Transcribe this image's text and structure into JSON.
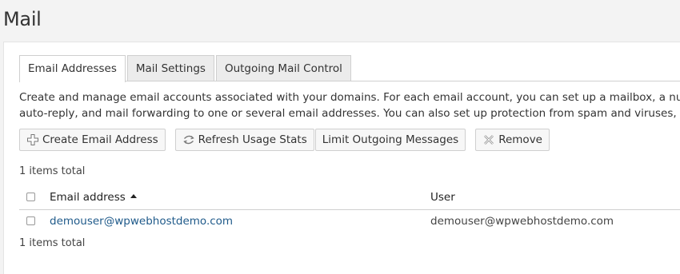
{
  "page": {
    "title": "Mail"
  },
  "tabs": [
    {
      "label": "Email Addresses",
      "active": true
    },
    {
      "label": "Mail Settings",
      "active": false
    },
    {
      "label": "Outgoing Mail Control",
      "active": false
    }
  ],
  "description": {
    "line1": "Create and manage email accounts associated with your domains. For each email account, you can set up a mailbox, a number of additio",
    "line2": "auto-reply, and mail forwarding to one or several email addresses. You can also set up protection from spam and viruses, if these service"
  },
  "toolbar": {
    "create_label": "Create Email Address",
    "refresh_label": "Refresh Usage Stats",
    "limit_label": "Limit Outgoing Messages",
    "remove_label": "Remove"
  },
  "list": {
    "count_text": "1 items total",
    "columns": {
      "email": "Email address",
      "user": "User"
    },
    "sort": "ascending",
    "rows": [
      {
        "email": "demouser@wpwebhostdemo.com",
        "user": "demouser@wpwebhostdemo.com"
      }
    ]
  },
  "colors": {
    "link": "#1f5a8a",
    "background": "#f3f3f3",
    "panel": "#ffffff"
  }
}
